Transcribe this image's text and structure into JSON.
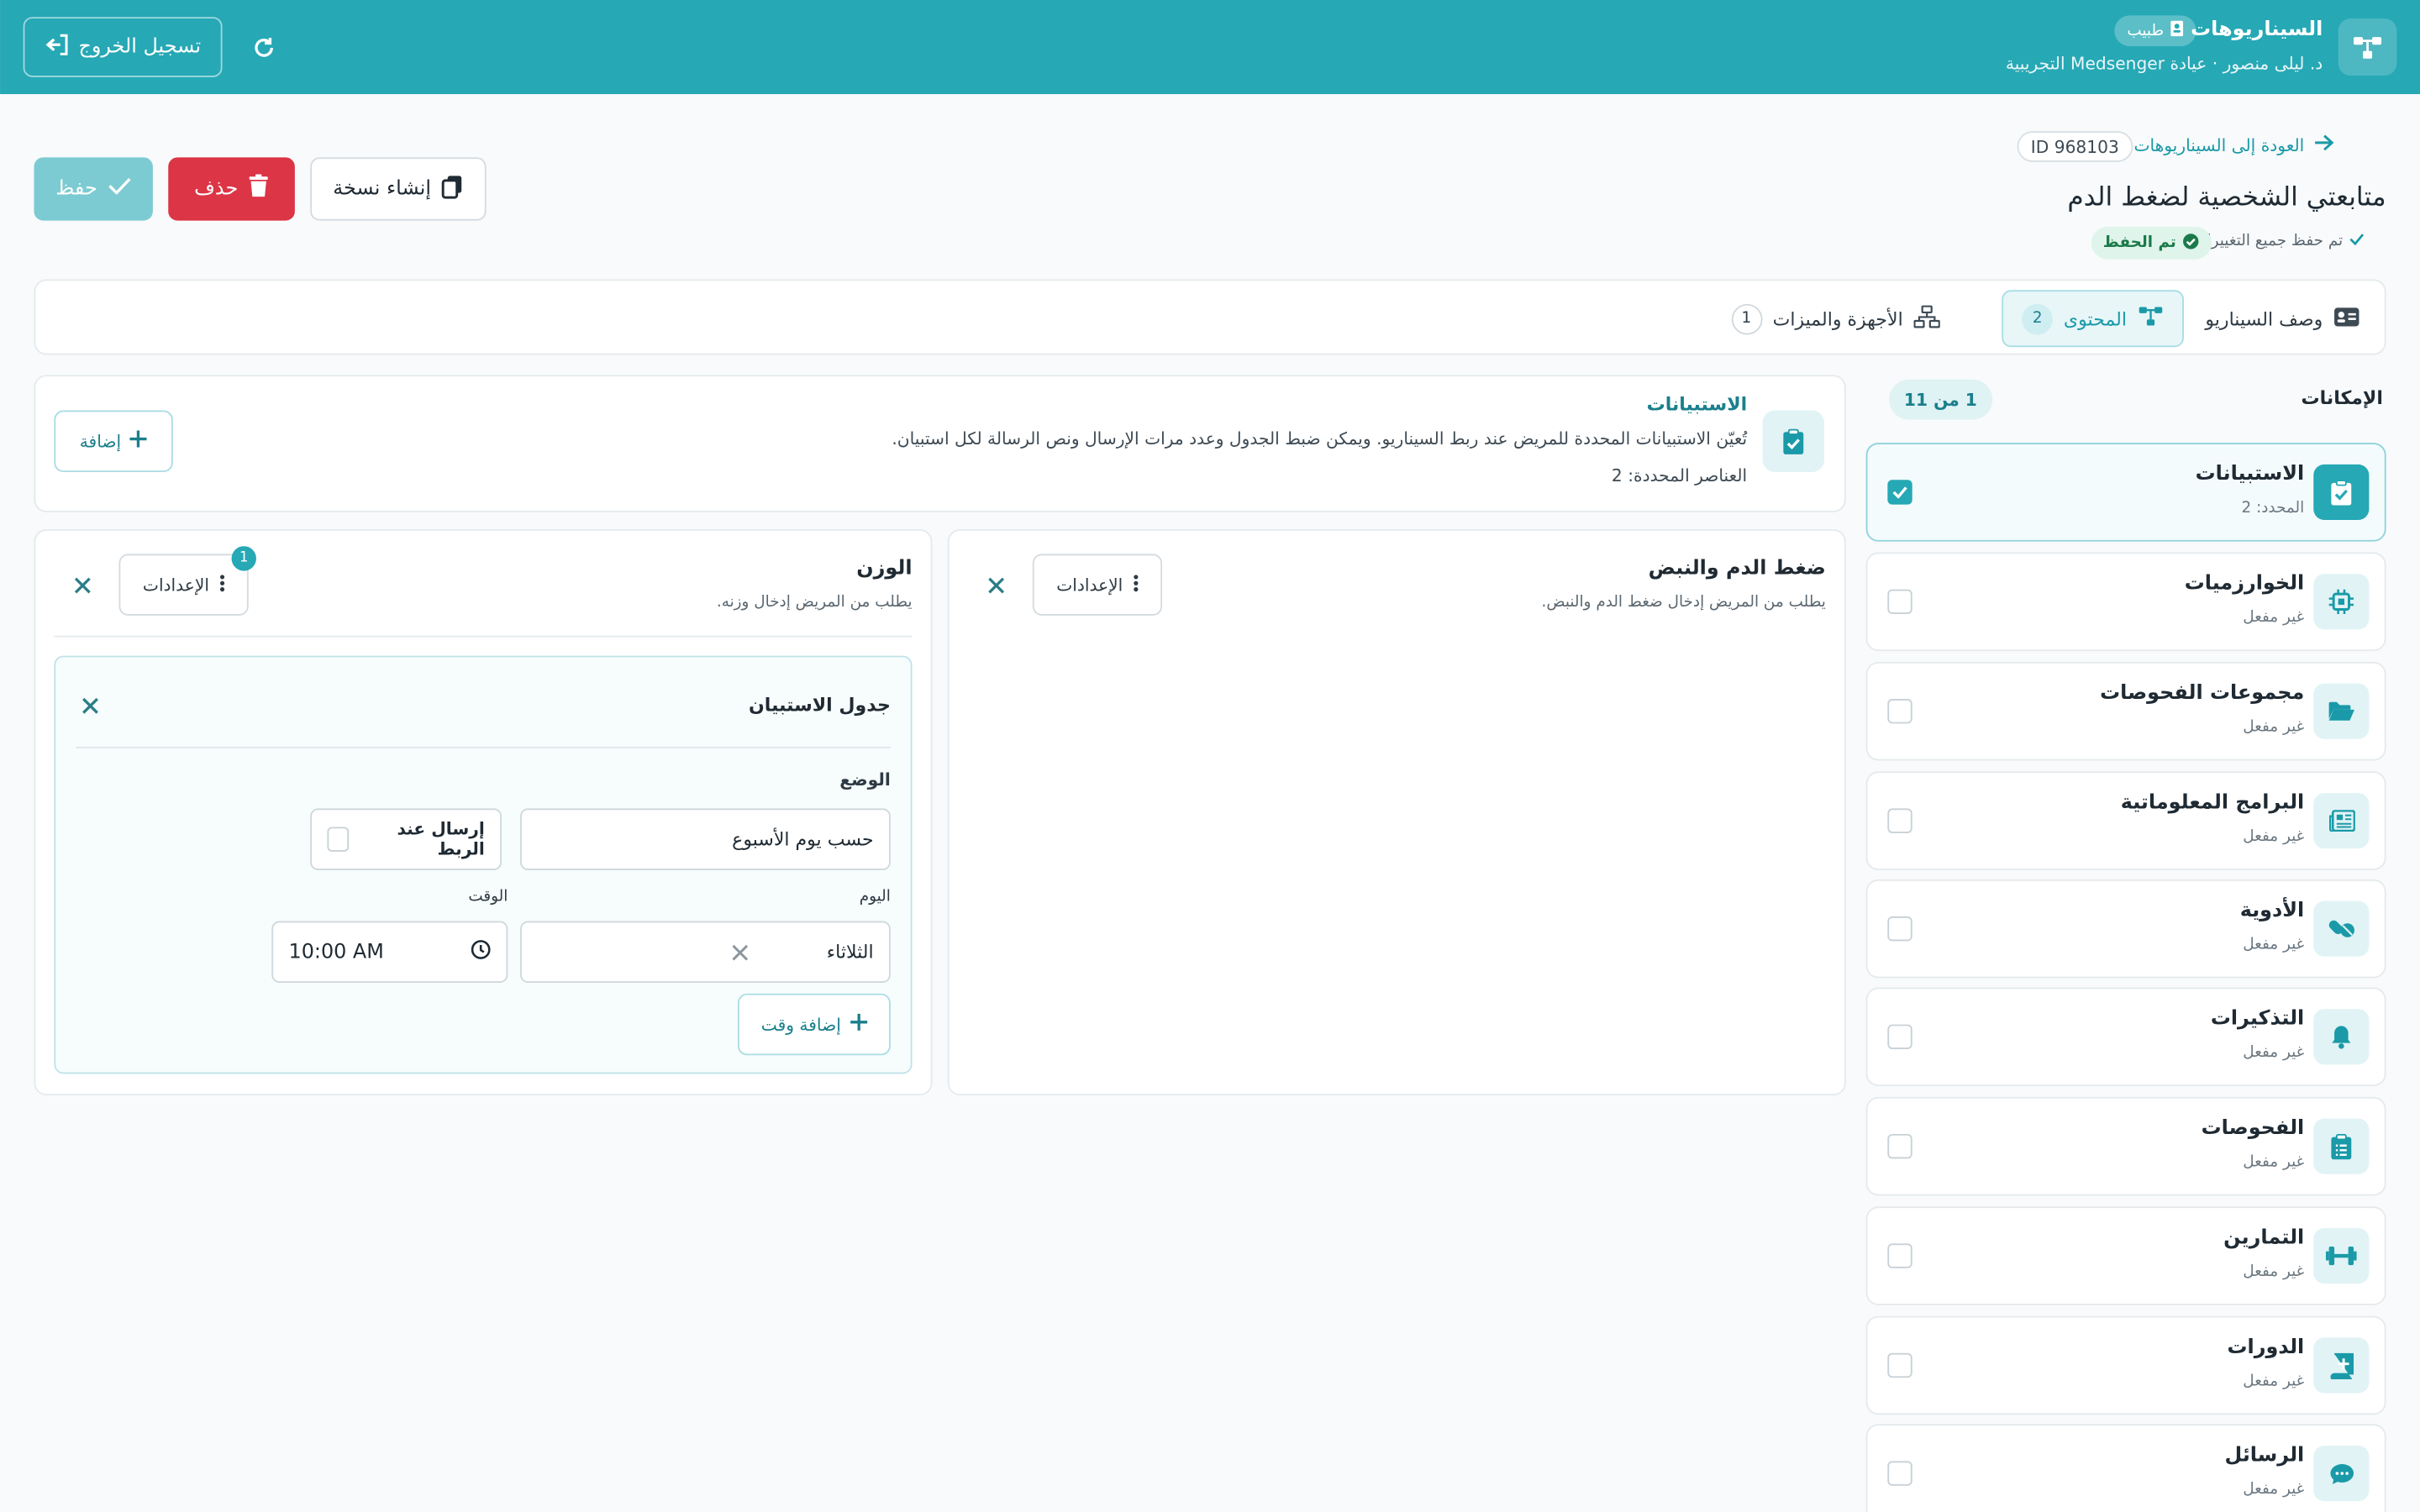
{
  "header": {
    "title": "السيناريوهات",
    "role": "طبيب",
    "subtitle": "د. ليلى منصور · عيادة Medsenger التجريبية",
    "logout_label": "تسجيل الخروج"
  },
  "page": {
    "back_label": "العودة إلى السيناريوهات",
    "id_label": "ID 968103",
    "title": "متابعتي الشخصية لضغط الدم",
    "saved_note": "تم حفظ جميع التغييرات",
    "saved_badge": "تم الحفظ"
  },
  "actions": {
    "copy_label": "إنشاء نسخة",
    "delete_label": "حذف",
    "save_label": "حفظ"
  },
  "tabs": [
    {
      "label": "وصف السيناريو",
      "badge": ""
    },
    {
      "label": "المحتوى",
      "badge": "2"
    },
    {
      "label": "الأجهزة والميزات",
      "badge": "1"
    }
  ],
  "sidebar": {
    "title": "الإمكانات",
    "count": "1 من 11",
    "items": [
      {
        "label": "الاستبيانات",
        "sub": "المحدد: 2",
        "icon": "clipboard-check-icon",
        "checked": true
      },
      {
        "label": "الخوارزميات",
        "sub": "غير مفعل",
        "icon": "chip-icon",
        "checked": false
      },
      {
        "label": "مجموعات الفحوصات",
        "sub": "غير مفعل",
        "icon": "folder-open-icon",
        "checked": false
      },
      {
        "label": "البرامج المعلوماتية",
        "sub": "غير مفعل",
        "icon": "newspaper-icon",
        "checked": false
      },
      {
        "label": "الأدوية",
        "sub": "غير مفعل",
        "icon": "pills-icon",
        "checked": false
      },
      {
        "label": "التذكيرات",
        "sub": "غير مفعل",
        "icon": "bell-icon",
        "checked": false
      },
      {
        "label": "الفحوصات",
        "sub": "غير مفعل",
        "icon": "clipboard-list-icon",
        "checked": false
      },
      {
        "label": "التمارين",
        "sub": "غير مفعل",
        "icon": "dumbbell-icon",
        "checked": false
      },
      {
        "label": "الدورات",
        "sub": "غير مفعل",
        "icon": "book-plus-icon",
        "checked": false
      },
      {
        "label": "الرسائل",
        "sub": "غير مفعل",
        "icon": "chat-icon",
        "checked": false
      }
    ]
  },
  "questionnaires": {
    "title": "الاستبيانات",
    "description": "تُعيّن الاستبيانات المحددة للمريض عند ربط السيناريو. ويمكن ضبط الجدول وعدد مرات الإرسال ونص الرسالة لكل استبيان.",
    "selected_count": "العناصر المحددة: 2",
    "add_label": "إضافة"
  },
  "cards": {
    "bp": {
      "title": "ضغط الدم والنبض",
      "subtitle": "يطلب من المريض إدخال ضغط الدم والنبض.",
      "settings_label": "الإعدادات"
    },
    "weight": {
      "title": "الوزن",
      "subtitle": "يطلب من المريض إدخال وزنه.",
      "settings_label": "الإعدادات",
      "settings_badge": "1",
      "schedule": {
        "title": "جدول الاستبيان",
        "mode_label": "الوضع",
        "mode_value": "حسب يوم الأسبوع",
        "send_on_link_label": "إرسال عند الربط",
        "day_label": "اليوم",
        "day_value": "الثلاثاء",
        "time_label": "الوقت",
        "time_value": "10:00 AM",
        "add_time_label": "إضافة وقت"
      }
    }
  },
  "colors": {
    "header": "#26a8b5",
    "accent": "#1a9aa8",
    "danger": "#dc3545",
    "save_disabled": "#7dcbd2",
    "success_bg": "#dff4ea"
  }
}
